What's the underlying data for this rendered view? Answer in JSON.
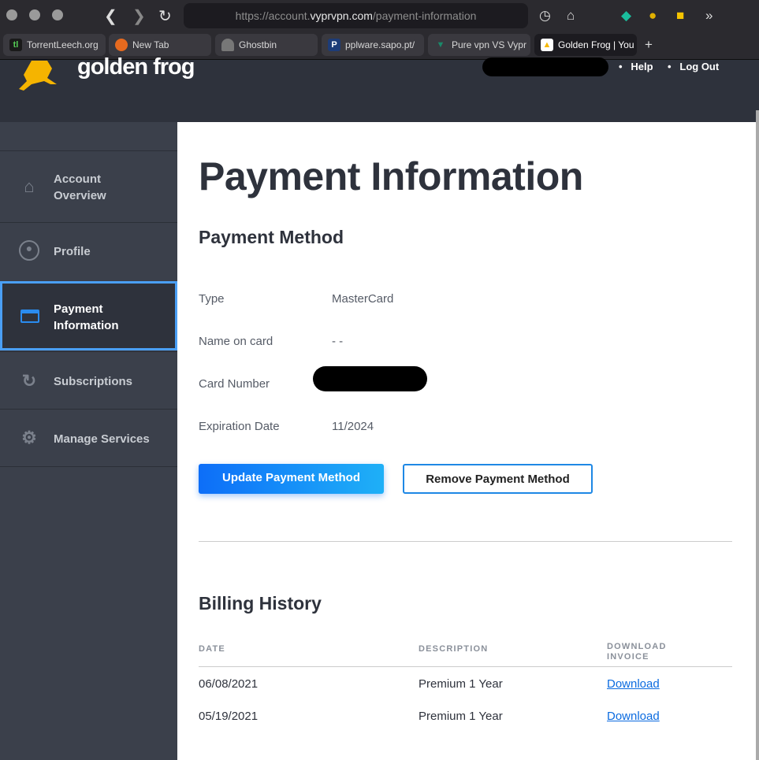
{
  "browser": {
    "url_prefix": "https://account.",
    "url_domain": "vyprvpn.com",
    "url_path": "/payment-information",
    "tabs": [
      {
        "label": "TorrentLeech.org"
      },
      {
        "label": "New Tab"
      },
      {
        "label": "Ghostbin"
      },
      {
        "label": "pplware.sapo.pt/"
      },
      {
        "label": "Pure vpn VS Vypr"
      },
      {
        "label": "Golden Frog | You"
      }
    ]
  },
  "header": {
    "logo": "golden frog",
    "help": "Help",
    "logout": "Log Out"
  },
  "sidebar": {
    "items": [
      {
        "label": "Account Overview"
      },
      {
        "label": "Profile"
      },
      {
        "label": "Payment Information"
      },
      {
        "label": "Subscriptions"
      },
      {
        "label": "Manage Services"
      }
    ]
  },
  "main": {
    "title": "Payment Information",
    "method_heading": "Payment Method",
    "fields": [
      {
        "label": "Type",
        "value": "MasterCard"
      },
      {
        "label": "Name on card",
        "value": "- -"
      },
      {
        "label": "Card Number",
        "value": ""
      },
      {
        "label": "Expiration Date",
        "value": "11/2024"
      }
    ],
    "update_btn": "Update Payment Method",
    "remove_btn": "Remove Payment Method",
    "billing_heading": "Billing History",
    "columns": [
      "DATE",
      "DESCRIPTION",
      "DOWNLOAD INVOICE"
    ],
    "rows": [
      {
        "date": "06/08/2021",
        "description": "Premium 1 Year",
        "link": "Download"
      },
      {
        "date": "05/19/2021",
        "description": "Premium 1 Year",
        "link": "Download"
      }
    ]
  }
}
